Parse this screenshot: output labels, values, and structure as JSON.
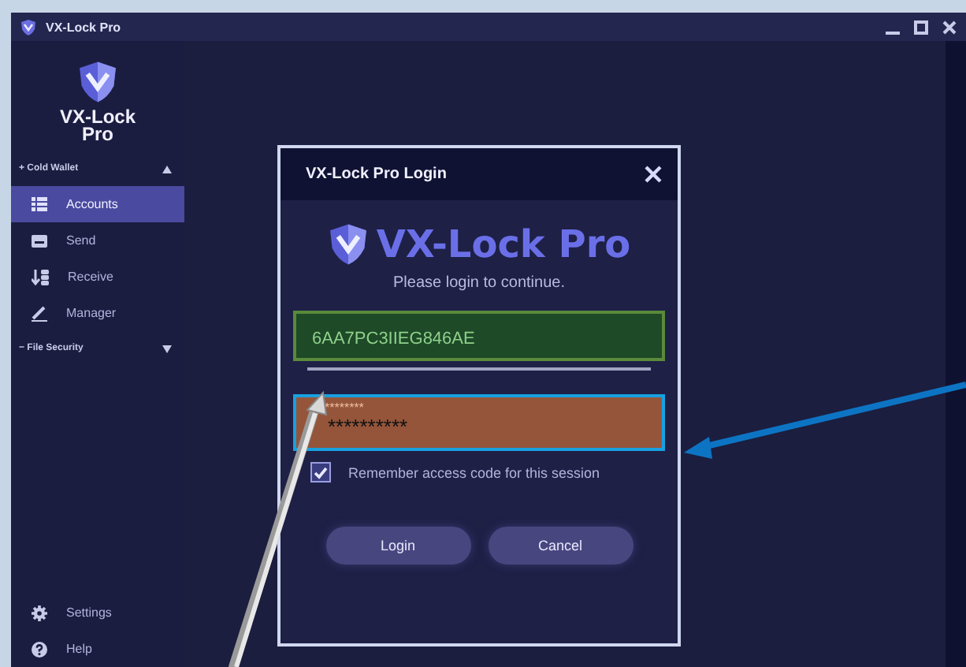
{
  "window": {
    "title": "VX-Lock Pro"
  },
  "sidebar": {
    "logo": "VX-Lock Pro",
    "sections": [
      {
        "label": "+ Cold Wallet",
        "expanded": true,
        "items": [
          {
            "label": "Accounts",
            "selected": true
          },
          {
            "label": "Send",
            "selected": false
          },
          {
            "label": "Receive",
            "selected": false
          },
          {
            "label": "Manager",
            "selected": false
          }
        ]
      },
      {
        "label": "− File Security",
        "expanded": false
      }
    ],
    "footer": [
      {
        "label": "Settings"
      },
      {
        "label": "Help"
      }
    ]
  },
  "dialog": {
    "title": "VX-Lock Pro Login",
    "brand": "VX-Lock Pro",
    "subtitle": "Please login to continue.",
    "account_field": {
      "value": "6AA7PC3IIEG846AE"
    },
    "password_field": {
      "label": "********",
      "value": "**********"
    },
    "remember": {
      "label": "Remember access code for this session",
      "checked": true
    },
    "buttons": [
      "Login",
      "Cancel"
    ]
  }
}
